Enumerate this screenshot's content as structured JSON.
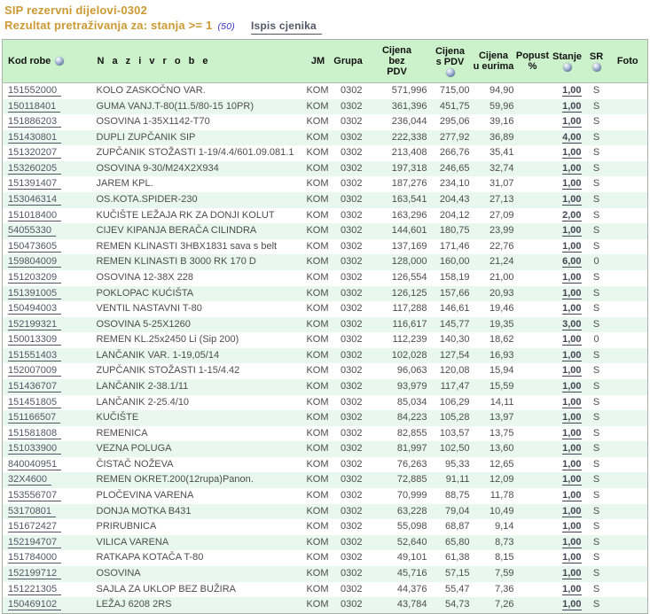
{
  "page": {
    "title": "SIP rezervni dijelovi-0302",
    "subtitle": "Rezultat pretraživanja za: stanja >= 1",
    "result_count": "(50)",
    "print_link_label": "Ispis cjenika"
  },
  "colors": {
    "title_orange": "#cc9933",
    "count_blue": "#3333cc",
    "link_slate": "#555566",
    "header_green": "#ccf2cc",
    "row_alt_green": "#e8f8ee",
    "table_border": "#a8b0a8",
    "body_text": "#4d4d4d"
  },
  "table": {
    "headers": {
      "code": "Kod robe",
      "name": "N a z i v   r o b e",
      "jm": "JM",
      "grupa": "Grupa",
      "price_no_vat": "Cijena\nbez\nPDV",
      "price_vat": "Cijena\ns PDV",
      "price_eur": "Cijena\nu eurima",
      "discount": "Popust\n%",
      "stock": "Stanje",
      "sr": "SR",
      "photo": "Foto"
    },
    "header_icons": [
      "sort-orb-code",
      "sort-orb-price-vat",
      "sort-orb-stock",
      "sort-orb-sr"
    ],
    "rows": [
      {
        "code": "151552000",
        "name": "KOLO ZASKOČNO VAR.",
        "jm": "KOM",
        "grupa": "0302",
        "bez": "571,996",
        "spdv": "715,00",
        "eur": "94,90",
        "popust": "",
        "stanje": "1,00",
        "sr": "S",
        "foto": ""
      },
      {
        "code": "150118401",
        "name": "GUMA VANJ.T-80(11.5/80-15 10PR)",
        "jm": "KOM",
        "grupa": "0302",
        "bez": "361,396",
        "spdv": "451,75",
        "eur": "59,96",
        "popust": "",
        "stanje": "1,00",
        "sr": "S",
        "foto": ""
      },
      {
        "code": "151886203",
        "name": "OSOVINA 1-35X1142-T70",
        "jm": "KOM",
        "grupa": "0302",
        "bez": "236,044",
        "spdv": "295,06",
        "eur": "39,16",
        "popust": "",
        "stanje": "1,00",
        "sr": "S",
        "foto": ""
      },
      {
        "code": "151430801",
        "name": "DUPLI ZUPČANIK SIP",
        "jm": "KOM",
        "grupa": "0302",
        "bez": "222,338",
        "spdv": "277,92",
        "eur": "36,89",
        "popust": "",
        "stanje": "4,00",
        "sr": "S",
        "foto": ""
      },
      {
        "code": "151320207",
        "name": "ZUPČANIK STOŽASTI 1-19/4.4/601.09.081.1",
        "jm": "KOM",
        "grupa": "0302",
        "bez": "213,408",
        "spdv": "266,76",
        "eur": "35,41",
        "popust": "",
        "stanje": "1,00",
        "sr": "S",
        "foto": ""
      },
      {
        "code": "153260205",
        "name": "OSOVINA 9-30/M24X2X934",
        "jm": "KOM",
        "grupa": "0302",
        "bez": "197,318",
        "spdv": "246,65",
        "eur": "32,74",
        "popust": "",
        "stanje": "1,00",
        "sr": "S",
        "foto": ""
      },
      {
        "code": "151391407",
        "name": "JAREM KPL.",
        "jm": "KOM",
        "grupa": "0302",
        "bez": "187,276",
        "spdv": "234,10",
        "eur": "31,07",
        "popust": "",
        "stanje": "1,00",
        "sr": "S",
        "foto": ""
      },
      {
        "code": "153046314",
        "name": "OS.KOTA.SPIDER-230",
        "jm": "KOM",
        "grupa": "0302",
        "bez": "163,541",
        "spdv": "204,43",
        "eur": "27,13",
        "popust": "",
        "stanje": "1,00",
        "sr": "S",
        "foto": ""
      },
      {
        "code": "151018400",
        "name": "KUČIŠTE LEŽAJA RK ZA DONJI KOLUT",
        "jm": "KOM",
        "grupa": "0302",
        "bez": "163,296",
        "spdv": "204,12",
        "eur": "27,09",
        "popust": "",
        "stanje": "2,00",
        "sr": "S",
        "foto": ""
      },
      {
        "code": "54055330",
        "name": "CIJEV KIPANJA BERAČA CILINDRA",
        "jm": "KOM",
        "grupa": "0302",
        "bez": "144,601",
        "spdv": "180,75",
        "eur": "23,99",
        "popust": "",
        "stanje": "1,00",
        "sr": "S",
        "foto": ""
      },
      {
        "code": "150473605",
        "name": "REMEN KLINASTI 3HBX1831 sava s belt",
        "jm": "KOM",
        "grupa": "0302",
        "bez": "137,169",
        "spdv": "171,46",
        "eur": "22,76",
        "popust": "",
        "stanje": "1,00",
        "sr": "S",
        "foto": ""
      },
      {
        "code": "159804009",
        "name": "REMEN KLINASTI B 3000 RK 170 D",
        "jm": "KOM",
        "grupa": "0302",
        "bez": "128,000",
        "spdv": "160,00",
        "eur": "21,24",
        "popust": "",
        "stanje": "6,00",
        "sr": "0",
        "foto": ""
      },
      {
        "code": "151203209",
        "name": "OSOVINA 12-38X 228",
        "jm": "KOM",
        "grupa": "0302",
        "bez": "126,554",
        "spdv": "158,19",
        "eur": "21,00",
        "popust": "",
        "stanje": "1,00",
        "sr": "S",
        "foto": ""
      },
      {
        "code": "151391005",
        "name": "POKLOPAC KUĆIŠTA",
        "jm": "KOM",
        "grupa": "0302",
        "bez": "126,125",
        "spdv": "157,66",
        "eur": "20,93",
        "popust": "",
        "stanje": "1,00",
        "sr": "S",
        "foto": ""
      },
      {
        "code": "150494003",
        "name": "VENTIL NASTAVNI T-80",
        "jm": "KOM",
        "grupa": "0302",
        "bez": "117,288",
        "spdv": "146,61",
        "eur": "19,46",
        "popust": "",
        "stanje": "1,00",
        "sr": "S",
        "foto": ""
      },
      {
        "code": "152199321",
        "name": "OSOVINA 5-25X1260",
        "jm": "KOM",
        "grupa": "0302",
        "bez": "116,617",
        "spdv": "145,77",
        "eur": "19,35",
        "popust": "",
        "stanje": "3,00",
        "sr": "S",
        "foto": ""
      },
      {
        "code": "150013309",
        "name": "REMEN KL.25x2450 Li (Sip 200)",
        "jm": "KOM",
        "grupa": "0302",
        "bez": "112,239",
        "spdv": "140,30",
        "eur": "18,62",
        "popust": "",
        "stanje": "1,00",
        "sr": "0",
        "foto": ""
      },
      {
        "code": "151551403",
        "name": "LANČANIK VAR. 1-19,05/14",
        "jm": "KOM",
        "grupa": "0302",
        "bez": "102,028",
        "spdv": "127,54",
        "eur": "16,93",
        "popust": "",
        "stanje": "1,00",
        "sr": "S",
        "foto": ""
      },
      {
        "code": "152007009",
        "name": "ZUPČANIK STOŽASTI 1-15/4.42",
        "jm": "KOM",
        "grupa": "0302",
        "bez": "96,063",
        "spdv": "120,08",
        "eur": "15,94",
        "popust": "",
        "stanje": "1,00",
        "sr": "S",
        "foto": ""
      },
      {
        "code": "151436707",
        "name": "LANČANIK 2-38.1/11",
        "jm": "KOM",
        "grupa": "0302",
        "bez": "93,979",
        "spdv": "117,47",
        "eur": "15,59",
        "popust": "",
        "stanje": "1,00",
        "sr": "S",
        "foto": ""
      },
      {
        "code": "151451805",
        "name": "LANČANIK 2-25.4/10",
        "jm": "KOM",
        "grupa": "0302",
        "bez": "85,034",
        "spdv": "106,29",
        "eur": "14,11",
        "popust": "",
        "stanje": "1,00",
        "sr": "S",
        "foto": ""
      },
      {
        "code": "151166507",
        "name": "KUČIŠTE",
        "jm": "KOM",
        "grupa": "0302",
        "bez": "84,223",
        "spdv": "105,28",
        "eur": "13,97",
        "popust": "",
        "stanje": "1,00",
        "sr": "S",
        "foto": ""
      },
      {
        "code": "151581808",
        "name": "REMENICA",
        "jm": "KOM",
        "grupa": "0302",
        "bez": "82,855",
        "spdv": "103,57",
        "eur": "13,75",
        "popust": "",
        "stanje": "1,00",
        "sr": "S",
        "foto": ""
      },
      {
        "code": "151033900",
        "name": "VEZNA POLUGA",
        "jm": "KOM",
        "grupa": "0302",
        "bez": "81,997",
        "spdv": "102,50",
        "eur": "13,60",
        "popust": "",
        "stanje": "1,00",
        "sr": "S",
        "foto": ""
      },
      {
        "code": "840040951",
        "name": "ČISTAČ NOŽEVA",
        "jm": "KOM",
        "grupa": "0302",
        "bez": "76,263",
        "spdv": "95,33",
        "eur": "12,65",
        "popust": "",
        "stanje": "1,00",
        "sr": "S",
        "foto": ""
      },
      {
        "code": "32X4600",
        "name": "REMEN OKRET.200(12rupa)Panon.",
        "jm": "KOM",
        "grupa": "0302",
        "bez": "72,885",
        "spdv": "91,11",
        "eur": "12,09",
        "popust": "",
        "stanje": "1,00",
        "sr": "S",
        "foto": ""
      },
      {
        "code": "153556707",
        "name": "PLOČEVINA VARENA",
        "jm": "KOM",
        "grupa": "0302",
        "bez": "70,999",
        "spdv": "88,75",
        "eur": "11,78",
        "popust": "",
        "stanje": "1,00",
        "sr": "S",
        "foto": ""
      },
      {
        "code": "53170801",
        "name": "DONJA MOTKA B431",
        "jm": "KOM",
        "grupa": "0302",
        "bez": "63,228",
        "spdv": "79,04",
        "eur": "10,49",
        "popust": "",
        "stanje": "1,00",
        "sr": "S",
        "foto": ""
      },
      {
        "code": "151672427",
        "name": "PRIRUBNICA",
        "jm": "KOM",
        "grupa": "0302",
        "bez": "55,098",
        "spdv": "68,87",
        "eur": "9,14",
        "popust": "",
        "stanje": "1,00",
        "sr": "S",
        "foto": ""
      },
      {
        "code": "152194707",
        "name": "VILICA VARENA",
        "jm": "KOM",
        "grupa": "0302",
        "bez": "52,640",
        "spdv": "65,80",
        "eur": "8,73",
        "popust": "",
        "stanje": "1,00",
        "sr": "S",
        "foto": ""
      },
      {
        "code": "151784000",
        "name": "RATKAPA KOTAČA T-80",
        "jm": "KOM",
        "grupa": "0302",
        "bez": "49,101",
        "spdv": "61,38",
        "eur": "8,15",
        "popust": "",
        "stanje": "1,00",
        "sr": "S",
        "foto": ""
      },
      {
        "code": "152199712",
        "name": "OSOVINA",
        "jm": "KOM",
        "grupa": "0302",
        "bez": "45,716",
        "spdv": "57,15",
        "eur": "7,59",
        "popust": "",
        "stanje": "1,00",
        "sr": "S",
        "foto": ""
      },
      {
        "code": "151221305",
        "name": "SAJLA ZA UKLOP BEZ BUŽIRA",
        "jm": "KOM",
        "grupa": "0302",
        "bez": "44,376",
        "spdv": "55,47",
        "eur": "7,36",
        "popust": "",
        "stanje": "1,00",
        "sr": "S",
        "foto": ""
      },
      {
        "code": "150469102",
        "name": "LEŽAJ 6208 2RS",
        "jm": "KOM",
        "grupa": "0302",
        "bez": "43,784",
        "spdv": "54,73",
        "eur": "7,26",
        "popust": "",
        "stanje": "1,00",
        "sr": "S",
        "foto": ""
      }
    ]
  }
}
